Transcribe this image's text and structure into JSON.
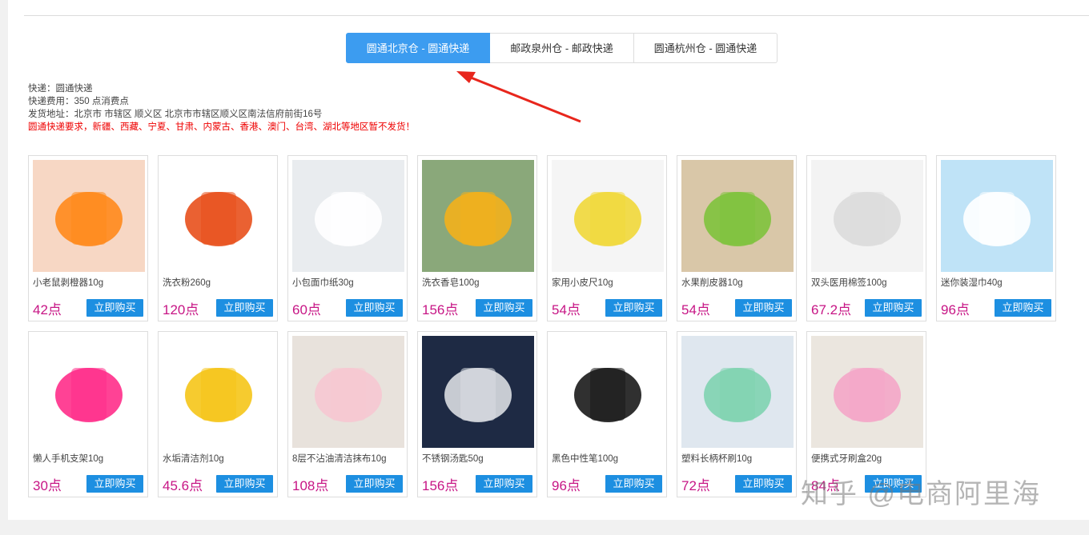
{
  "tabs": [
    {
      "label": "圆通北京仓 - 圆通快递",
      "active": true
    },
    {
      "label": "邮政泉州仓 - 邮政快递",
      "active": false
    },
    {
      "label": "圆通杭州仓 - 圆通快递",
      "active": false
    }
  ],
  "info": {
    "express": "快递：圆通快递",
    "fee": "快递费用：350 点消费点",
    "address": "发货地址：北京市 市辖区 顺义区 北京市市辖区顺义区南法信府前街16号",
    "warning": "圆通快递要求，新疆、西藏、宁夏、甘肃、内蒙古、香港、澳门、台湾、湖北等地区暂不发货！"
  },
  "buy_label": "立即购买",
  "products": [
    {
      "name": "小老鼠剥橙器10g",
      "price": "42点",
      "icon": "orange-peeler",
      "colors": [
        "#f7d7c4",
        "#ff8a1c"
      ]
    },
    {
      "name": "洗衣粉260g",
      "price": "120点",
      "icon": "detergent-bag",
      "colors": [
        "#ffffff",
        "#e8501c"
      ]
    },
    {
      "name": "小包面巾纸30g",
      "price": "60点",
      "icon": "tissue-pack",
      "colors": [
        "#e9ecef",
        "#ffffff"
      ]
    },
    {
      "name": "洗衣香皂100g",
      "price": "156点",
      "icon": "soap-bar",
      "colors": [
        "#8aa87a",
        "#f2b01c"
      ]
    },
    {
      "name": "家用小皮尺10g",
      "price": "54点",
      "icon": "tape-measure",
      "colors": [
        "#f5f5f5",
        "#f1d83a"
      ]
    },
    {
      "name": "水果削皮器10g",
      "price": "54点",
      "icon": "fruit-peeler",
      "colors": [
        "#d9c7a8",
        "#7ec23c"
      ]
    },
    {
      "name": "双头医用棉签100g",
      "price": "67.2点",
      "icon": "cotton-swabs",
      "colors": [
        "#f3f3f3",
        "#dcdcdc"
      ]
    },
    {
      "name": "迷你装湿巾40g",
      "price": "96点",
      "icon": "wet-wipes",
      "colors": [
        "#bfe3f7",
        "#ffffff"
      ]
    },
    {
      "name": "懒人手机支架10g",
      "price": "30点",
      "icon": "phone-stand",
      "colors": [
        "#ffffff",
        "#ff2d8a"
      ]
    },
    {
      "name": "水垢清洁剂10g",
      "price": "45.6点",
      "icon": "descaler",
      "colors": [
        "#ffffff",
        "#f5c518"
      ]
    },
    {
      "name": "8层不沾油清洁抹布10g",
      "price": "108点",
      "icon": "cleaning-cloth",
      "colors": [
        "#e8e2dc",
        "#f6c8d2"
      ]
    },
    {
      "name": "不锈钢汤匙50g",
      "price": "156点",
      "icon": "spoons",
      "colors": [
        "#1e2a44",
        "#d9dde2"
      ]
    },
    {
      "name": "黑色中性笔100g",
      "price": "96点",
      "icon": "gel-pens",
      "colors": [
        "#ffffff",
        "#1a1a1a"
      ]
    },
    {
      "name": "塑料长柄杯刷10g",
      "price": "72点",
      "icon": "cup-brush",
      "colors": [
        "#dfe7ef",
        "#7fd3b0"
      ]
    },
    {
      "name": "便携式牙刷盒20g",
      "price": "84点",
      "icon": "toothbrush-case",
      "colors": [
        "#ebe6df",
        "#f4a6c8"
      ]
    }
  ],
  "watermark": "知乎 @电商阿里海"
}
